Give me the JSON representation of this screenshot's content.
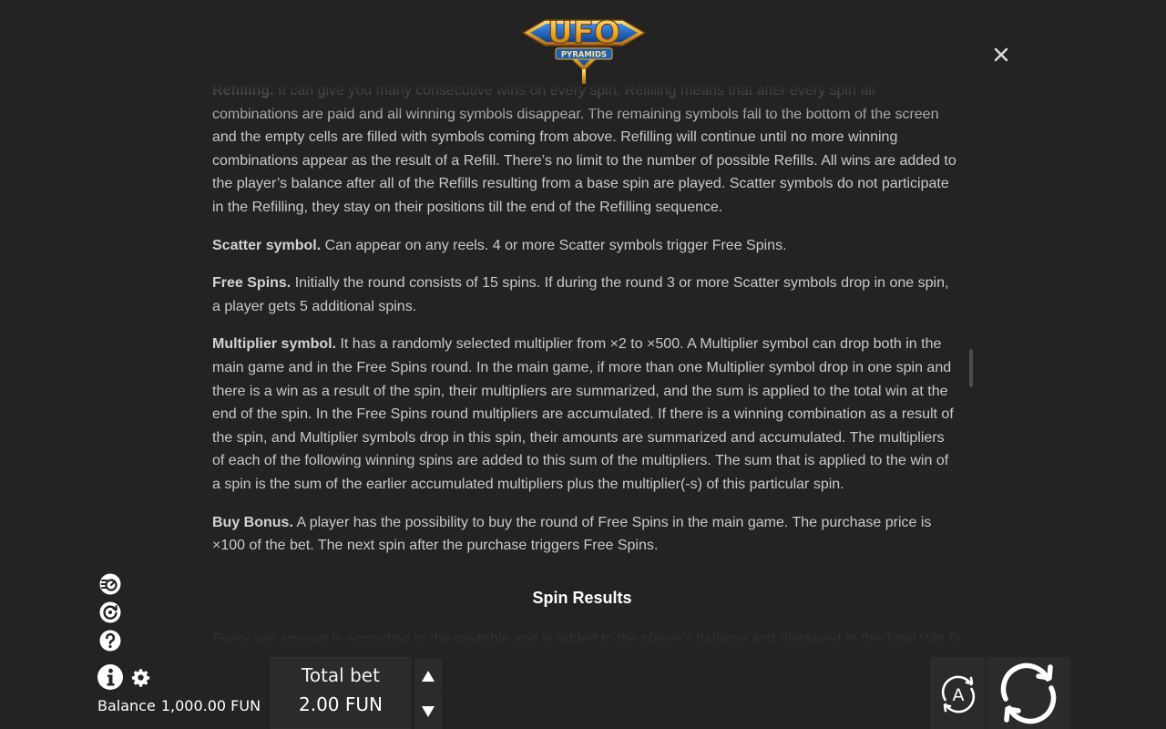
{
  "logo": {
    "title": "UFO",
    "subtitle": "PYRAMIDS"
  },
  "rules": {
    "refilling": {
      "bold": "Refilling.",
      "text": "It can give you many consecutive wins on every spin. Refilling means that after every spin all combinations are paid and all winning symbols disappear. The remaining symbols fall to the bottom of the screen and the empty cells are filled with symbols coming from above. Refilling will continue until no more winning combinations appear as the result of a Refill. There’s no limit to the number of possible Refills. All wins are added to the player’s balance after all of the Refills resulting from a base spin are played. Scatter symbols do not participate in the Refilling, they stay on their positions till the end of the Refilling sequence."
    },
    "scatter": {
      "bold": "Scatter symbol.",
      "text": "Can appear on any reels. 4 or more Scatter symbols trigger Free Spins."
    },
    "free_spins": {
      "bold": "Free Spins.",
      "text": "Initially the round consists of 15 spins. If during the round 3 or more Scatter symbols drop in one spin, a player gets 5 additional spins."
    },
    "multiplier": {
      "bold": "Multiplier symbol.",
      "text": "It has a randomly selected multiplier from ×2 to ×500. A Multiplier symbol can drop both in the main game and in the Free Spins round. In the main game, if more than one Multiplier symbol drop in one spin and there is a win as a result of the spin, their multipliers are summarized, and the sum is applied to the total win at the end of the spin. In the Free Spins round multipliers are accumulated. If there is a winning combination as a result of the spin, and Multiplier symbols drop in this spin, their amounts are summarized and accumulated. The multipliers of each of the following winning spins are added to this sum of the multipliers. The sum that is applied to the win of a spin is the sum of the earlier accumulated multipliers plus the multiplier(-s) of this particular spin."
    },
    "buy_bonus": {
      "bold": "Buy Bonus.",
      "text": "A player has the possibility to buy the round of Free Spins in the main game. The purchase price is ×100 of the bet. The next spin after the purchase triggers Free Spins."
    },
    "spin_results_title": "Spin Results",
    "spin_results_text": "Every win amount is according to the paytable and is added to the player’s balance and displayed in the Total Win field."
  },
  "footer": {
    "balance_label": "Balance",
    "balance_value": "1,000.00 FUN",
    "total_bet_label": "Total bet",
    "total_bet_value": "2.00 FUN",
    "auto_label": "A"
  },
  "colors": {
    "background": "#232323",
    "text": "#c9c9c9",
    "logo_gold": "#e8a92a",
    "logo_blue": "#1d5fb5"
  }
}
